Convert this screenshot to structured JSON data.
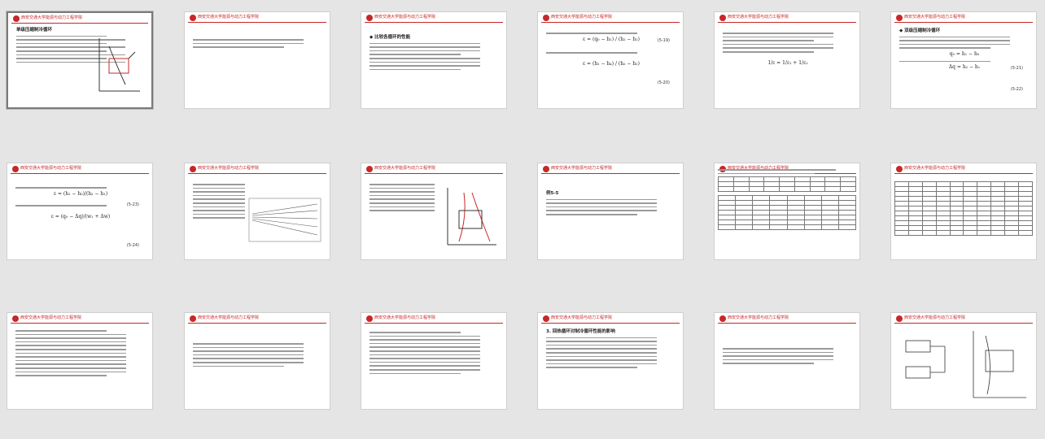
{
  "header_text": "西安交通大学能源与动力工程学院",
  "slides": [
    {
      "title": "单级压缩制冷循环",
      "type": "text-figure"
    },
    {
      "title": "",
      "type": "text"
    },
    {
      "title": "◆ 比较各循环的性能",
      "type": "text"
    },
    {
      "title": "",
      "type": "equations",
      "eq_numbers": [
        "(5-19)",
        "(5-20)"
      ]
    },
    {
      "title": "",
      "type": "text-eq"
    },
    {
      "title": "◆ 双级压缩制冷循环",
      "type": "text-eq",
      "eq_numbers": [
        "(5-21)",
        "(5-22)"
      ]
    },
    {
      "title": "",
      "type": "equations",
      "eq_numbers": [
        "(5-23)",
        "(5-24)"
      ]
    },
    {
      "title": "",
      "type": "text-chart"
    },
    {
      "title": "",
      "type": "text-figure"
    },
    {
      "title": "例5-5",
      "type": "example"
    },
    {
      "title": "",
      "type": "table"
    },
    {
      "title": "",
      "type": "table"
    },
    {
      "title": "",
      "type": "text"
    },
    {
      "title": "",
      "type": "text"
    },
    {
      "title": "",
      "type": "text"
    },
    {
      "title": "3. 回热循环对制冷循环性能的影响",
      "type": "text"
    },
    {
      "title": "",
      "type": "text"
    },
    {
      "title": "",
      "type": "figure"
    }
  ]
}
